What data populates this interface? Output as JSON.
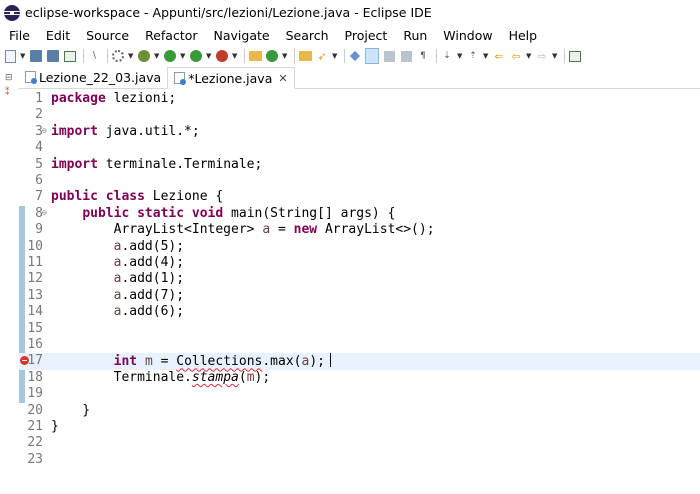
{
  "window": {
    "title": "eclipse-workspace - Appunti/src/lezioni/Lezione.java - Eclipse IDE"
  },
  "menu": [
    "File",
    "Edit",
    "Source",
    "Refactor",
    "Navigate",
    "Search",
    "Project",
    "Run",
    "Window",
    "Help"
  ],
  "tabs": [
    {
      "label": "Lezione_22_03.java",
      "active": false
    },
    {
      "label": "*Lezione.java",
      "active": true,
      "close": "✕"
    }
  ],
  "colors": {
    "keyword": "#7f0055",
    "local_variable": "#6a3e3e",
    "current_line": "#e8f2fe",
    "change_ruler": "#a5c6dd",
    "error": "#d9362b"
  },
  "editor": {
    "changed_lines": [
      8,
      19
    ],
    "current_line": 17,
    "error_line": 17,
    "lines": [
      {
        "n": "1",
        "segs": [
          {
            "t": "package",
            "c": "kw"
          },
          {
            "t": " lezioni;"
          }
        ]
      },
      {
        "n": "2",
        "segs": []
      },
      {
        "n": "3",
        "fold": "⊖",
        "segs": [
          {
            "t": "import",
            "c": "kw"
          },
          {
            "t": " java.util.*;"
          }
        ]
      },
      {
        "n": "4",
        "segs": []
      },
      {
        "n": "5",
        "segs": [
          {
            "t": "import",
            "c": "kw"
          },
          {
            "t": " terminale.Terminale;"
          }
        ]
      },
      {
        "n": "6",
        "segs": []
      },
      {
        "n": "7",
        "segs": [
          {
            "t": "public",
            "c": "kw"
          },
          {
            "t": " "
          },
          {
            "t": "class",
            "c": "kw"
          },
          {
            "t": " Lezione {"
          }
        ]
      },
      {
        "n": "8",
        "fold": "⊖",
        "segs": [
          {
            "t": "    "
          },
          {
            "t": "public",
            "c": "kw"
          },
          {
            "t": " "
          },
          {
            "t": "static",
            "c": "kw"
          },
          {
            "t": " "
          },
          {
            "t": "void",
            "c": "kw"
          },
          {
            "t": " main(String[] args) {"
          }
        ]
      },
      {
        "n": "9",
        "segs": [
          {
            "t": "        ArrayList<Integer> "
          },
          {
            "t": "a",
            "c": "var"
          },
          {
            "t": " = "
          },
          {
            "t": "new",
            "c": "kw"
          },
          {
            "t": " ArrayList<>();"
          }
        ]
      },
      {
        "n": "10",
        "segs": [
          {
            "t": "        "
          },
          {
            "t": "a",
            "c": "var"
          },
          {
            "t": ".add(5);"
          }
        ]
      },
      {
        "n": "11",
        "segs": [
          {
            "t": "        "
          },
          {
            "t": "a",
            "c": "var"
          },
          {
            "t": ".add(4);"
          }
        ]
      },
      {
        "n": "12",
        "segs": [
          {
            "t": "        "
          },
          {
            "t": "a",
            "c": "var"
          },
          {
            "t": ".add(1);"
          }
        ]
      },
      {
        "n": "13",
        "segs": [
          {
            "t": "        "
          },
          {
            "t": "a",
            "c": "var"
          },
          {
            "t": ".add(7);"
          }
        ]
      },
      {
        "n": "14",
        "segs": [
          {
            "t": "        "
          },
          {
            "t": "a",
            "c": "var"
          },
          {
            "t": ".add(6);"
          }
        ]
      },
      {
        "n": "15",
        "segs": []
      },
      {
        "n": "16",
        "segs": []
      },
      {
        "n": "17",
        "segs": [
          {
            "t": "        "
          },
          {
            "t": "int",
            "c": "kw"
          },
          {
            "t": " "
          },
          {
            "t": "m",
            "c": "var"
          },
          {
            "t": " = "
          },
          {
            "t": "Collections",
            "c": "squig"
          },
          {
            "t": ".max("
          },
          {
            "t": "a",
            "c": "var"
          },
          {
            "t": ");"
          }
        ]
      },
      {
        "n": "18",
        "segs": [
          {
            "t": "        Terminale."
          },
          {
            "t": "stampa",
            "c": "it squig"
          },
          {
            "t": "("
          },
          {
            "t": "m",
            "c": "var"
          },
          {
            "t": ");"
          }
        ]
      },
      {
        "n": "19",
        "segs": []
      },
      {
        "n": "20",
        "segs": [
          {
            "t": "    }"
          }
        ]
      },
      {
        "n": "21",
        "segs": [
          {
            "t": "}"
          }
        ]
      },
      {
        "n": "22",
        "segs": []
      },
      {
        "n": "23",
        "segs": []
      }
    ]
  }
}
